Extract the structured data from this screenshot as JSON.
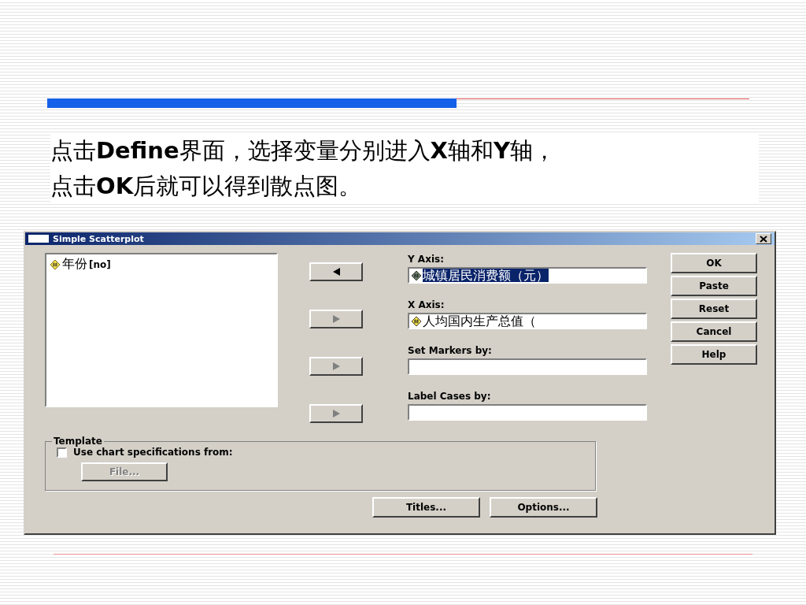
{
  "slide": {
    "heading_lines": [
      "点击**Define**界面，选择变量分别进入**X**轴和**Y**轴，",
      "点击**OK**后就可以得到散点图。"
    ]
  },
  "dialog": {
    "title": "Simple Scatterplot",
    "variables": [
      {
        "name": "年份",
        "tag": "[no]"
      }
    ],
    "arrow_buttons": [
      {
        "kind": "left",
        "disabled": false
      },
      {
        "kind": "right",
        "disabled": true
      },
      {
        "kind": "right",
        "disabled": true
      },
      {
        "kind": "right",
        "disabled": true
      }
    ],
    "target_fields": [
      {
        "label": "Y Axis:",
        "value": "城镇居民消费额（元）",
        "selected": true
      },
      {
        "label": "X Axis:",
        "value": "人均国内生产总值（",
        "selected": false
      },
      {
        "label": "Set Markers by:"
      },
      {
        "label": "Label Cases by:"
      }
    ],
    "buttons": [
      "OK",
      "Paste",
      "Reset",
      "Cancel",
      "Help"
    ],
    "template": {
      "title": "Template",
      "checkbox": {
        "label": "Use chart specifications from:",
        "checked": false
      },
      "file_button": {
        "label": "File...",
        "disabled": true
      }
    },
    "bottom_buttons": [
      "Titles...",
      "Options..."
    ]
  }
}
